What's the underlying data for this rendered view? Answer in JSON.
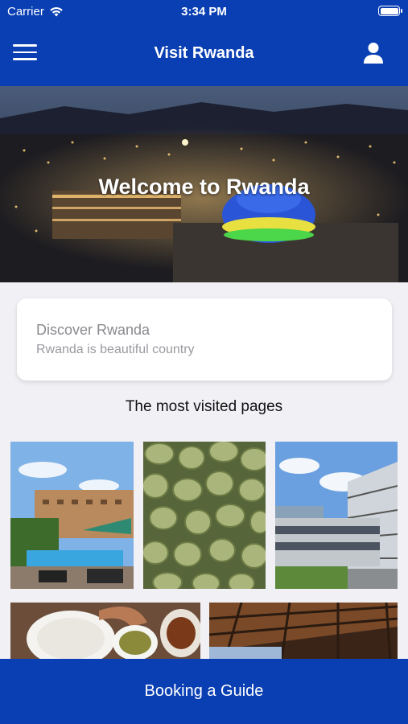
{
  "status_bar": {
    "carrier": "Carrier",
    "time": "3:34 PM"
  },
  "nav": {
    "title": "Visit Rwanda"
  },
  "hero": {
    "title": "Welcome to Rwanda"
  },
  "card": {
    "title": "Discover Rwanda",
    "subtitle": "Rwanda is beautiful country"
  },
  "section": {
    "title": "The most visited pages"
  },
  "bottom": {
    "label": "Booking a Guide"
  },
  "colors": {
    "brand": "#0a3fb3",
    "background": "#f1f0f5"
  }
}
